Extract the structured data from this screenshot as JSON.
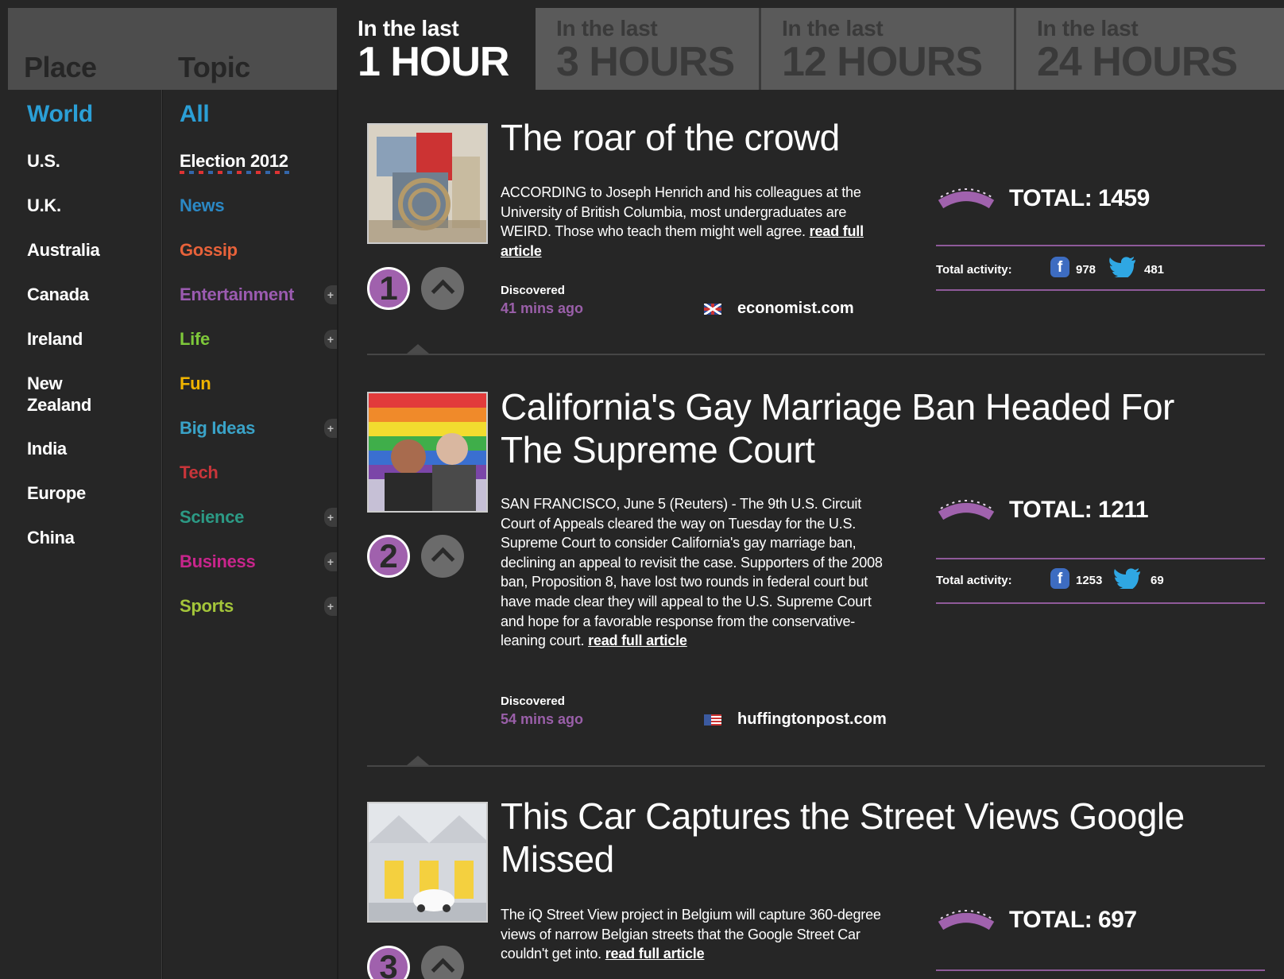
{
  "sidebar": {
    "place_header": "Place",
    "topic_header": "Topic",
    "places": [
      "World",
      "U.S.",
      "U.K.",
      "Australia",
      "Canada",
      "Ireland",
      "New Zealand",
      "India",
      "Europe",
      "China"
    ],
    "topics": [
      "All",
      "Election 2012",
      "News",
      "Gossip",
      "Entertainment",
      "Life",
      "Fun",
      "Big Ideas",
      "Tech",
      "Science",
      "Business",
      "Sports"
    ],
    "expand_symbol": "+"
  },
  "colors": {
    "world": "#2b9fd6",
    "all": "#2b9fd6",
    "news": "#2b88c4",
    "gossip": "#e8623a",
    "entertainment": "#9b5bb0",
    "life": "#7ec83a",
    "fun": "#f0b400",
    "big_ideas": "#3aa3c8",
    "tech": "#c9353a",
    "science": "#2c9a85",
    "business": "#c8258c",
    "sports": "#a4c63a",
    "accent_purple": "#9a5fa9"
  },
  "tabs": [
    {
      "small": "In the last",
      "big": "1 HOUR"
    },
    {
      "small": "In the last",
      "big": "3 HOURS"
    },
    {
      "small": "In the last",
      "big": "12 HOURS"
    },
    {
      "small": "In the last",
      "big": "24 HOURS"
    }
  ],
  "labels": {
    "discovered": "Discovered",
    "read_more": "read full article",
    "total_activity": "Total activity:",
    "facebook_glyph": "f"
  },
  "articles": [
    {
      "rank": "1",
      "title": "The roar of the crowd",
      "summary": "ACCORDING to Joseph Henrich and his colleagues at the University of British Columbia, most undergraduates are WEIRD. Those who teach them might well agree.",
      "discovered": "41 mins ago",
      "source": "economist.com",
      "total": "TOTAL: 1459",
      "facebook": "978",
      "twitter": "481",
      "flag": "uk"
    },
    {
      "rank": "2",
      "title": "California's Gay Marriage Ban Headed For The Supreme Court",
      "summary": "SAN FRANCISCO, June 5 (Reuters) - The 9th U.S. Circuit Court of Appeals cleared the way on Tuesday for the U.S. Supreme Court to consider California's gay marriage ban, declining an appeal to revisit the case. Supporters of the 2008 ban, Proposition 8, have lost two rounds in federal court but have made clear they will appeal to the U.S. Supreme Court and hope for a favorable response from the conservative-leaning court.",
      "discovered": "54 mins ago",
      "source": "huffingtonpost.com",
      "total": "TOTAL: 1211",
      "facebook": "1253",
      "twitter": "69",
      "flag": "us"
    },
    {
      "rank": "3",
      "title": "This Car Captures the Street Views Google Missed",
      "summary": "The iQ Street View project in Belgium will capture 360-degree views of narrow Belgian streets that the Google Street Car couldn't get into.",
      "total": "TOTAL: 697"
    }
  ]
}
